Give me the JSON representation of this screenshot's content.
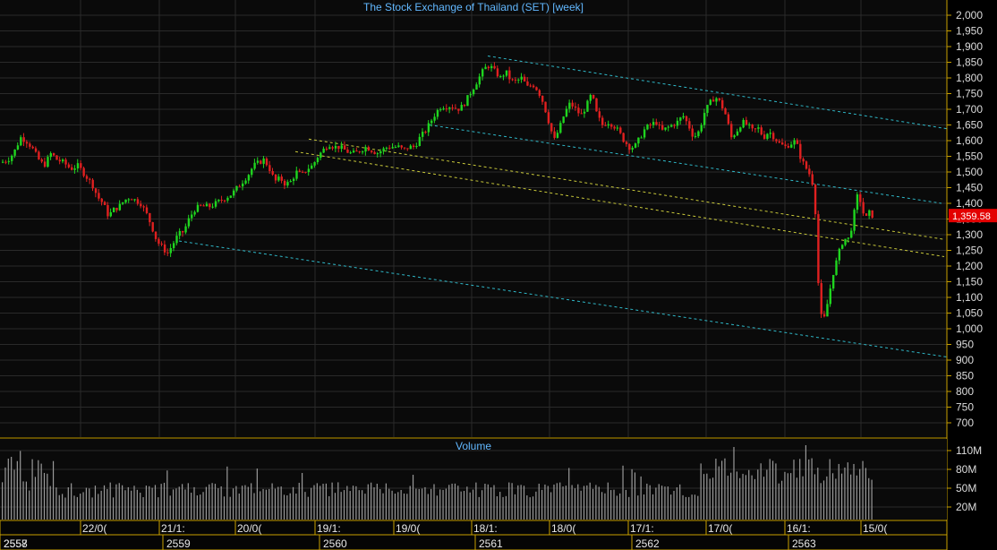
{
  "chart_data": [
    {
      "type": "candlestick",
      "title": "The Stock Exchange of Thailand (SET) [week]",
      "ylim": [
        650,
        2050
      ],
      "y_ticks": [
        "2,000",
        "1,950",
        "1,900",
        "1,850",
        "1,800",
        "1,750",
        "1,700",
        "1,650",
        "1,600",
        "1,550",
        "1,500",
        "1,450",
        "1,400",
        "1,350",
        "1,300",
        "1,250",
        "1,200",
        "1,150",
        "1,100",
        "1,050",
        "1,000",
        "950",
        "900",
        "850",
        "800",
        "750",
        "700"
      ],
      "last_price_label": "1,359.58",
      "last_price": 1359.58,
      "grid": true,
      "close_path": [
        [
          0,
          1530
        ],
        [
          8,
          1540
        ],
        [
          14,
          1560
        ],
        [
          22,
          1610
        ],
        [
          28,
          1600
        ],
        [
          34,
          1580
        ],
        [
          42,
          1540
        ],
        [
          48,
          1520
        ],
        [
          56,
          1560
        ],
        [
          62,
          1540
        ],
        [
          70,
          1530
        ],
        [
          78,
          1510
        ],
        [
          86,
          1520
        ],
        [
          94,
          1490
        ],
        [
          102,
          1460
        ],
        [
          108,
          1420
        ],
        [
          114,
          1400
        ],
        [
          120,
          1360
        ],
        [
          126,
          1380
        ],
        [
          132,
          1390
        ],
        [
          138,
          1410
        ],
        [
          144,
          1420
        ],
        [
          150,
          1410
        ],
        [
          156,
          1400
        ],
        [
          162,
          1370
        ],
        [
          168,
          1330
        ],
        [
          174,
          1280
        ],
        [
          180,
          1260
        ],
        [
          186,
          1240
        ],
        [
          192,
          1270
        ],
        [
          198,
          1300
        ],
        [
          204,
          1310
        ],
        [
          210,
          1350
        ],
        [
          216,
          1380
        ],
        [
          222,
          1390
        ],
        [
          228,
          1390
        ],
        [
          234,
          1390
        ],
        [
          240,
          1400
        ],
        [
          246,
          1410
        ],
        [
          252,
          1420
        ],
        [
          258,
          1430
        ],
        [
          264,
          1450
        ],
        [
          270,
          1470
        ],
        [
          276,
          1490
        ],
        [
          282,
          1520
        ],
        [
          288,
          1530
        ],
        [
          294,
          1540
        ],
        [
          300,
          1510
        ],
        [
          306,
          1470
        ],
        [
          312,
          1480
        ],
        [
          318,
          1460
        ],
        [
          324,
          1470
        ],
        [
          330,
          1500
        ],
        [
          336,
          1490
        ],
        [
          342,
          1510
        ],
        [
          348,
          1520
        ],
        [
          354,
          1550
        ],
        [
          360,
          1570
        ],
        [
          366,
          1590
        ],
        [
          372,
          1580
        ],
        [
          378,
          1580
        ],
        [
          384,
          1570
        ],
        [
          390,
          1560
        ],
        [
          396,
          1560
        ],
        [
          402,
          1570
        ],
        [
          408,
          1580
        ],
        [
          414,
          1570
        ],
        [
          420,
          1560
        ],
        [
          426,
          1570
        ],
        [
          432,
          1580
        ],
        [
          438,
          1580
        ],
        [
          444,
          1580
        ],
        [
          450,
          1570
        ],
        [
          456,
          1580
        ],
        [
          462,
          1580
        ],
        [
          468,
          1610
        ],
        [
          474,
          1630
        ],
        [
          480,
          1660
        ],
        [
          486,
          1690
        ],
        [
          492,
          1710
        ],
        [
          498,
          1710
        ],
        [
          504,
          1710
        ],
        [
          510,
          1700
        ],
        [
          516,
          1710
        ],
        [
          522,
          1740
        ],
        [
          528,
          1770
        ],
        [
          534,
          1800
        ],
        [
          540,
          1830
        ],
        [
          546,
          1840
        ],
        [
          552,
          1820
        ],
        [
          558,
          1800
        ],
        [
          564,
          1820
        ],
        [
          570,
          1790
        ],
        [
          576,
          1790
        ],
        [
          582,
          1800
        ],
        [
          588,
          1770
        ],
        [
          594,
          1780
        ],
        [
          600,
          1760
        ],
        [
          606,
          1720
        ],
        [
          612,
          1660
        ],
        [
          618,
          1600
        ],
        [
          624,
          1640
        ],
        [
          630,
          1690
        ],
        [
          636,
          1720
        ],
        [
          642,
          1700
        ],
        [
          648,
          1680
        ],
        [
          654,
          1710
        ],
        [
          660,
          1750
        ],
        [
          666,
          1680
        ],
        [
          672,
          1650
        ],
        [
          678,
          1660
        ],
        [
          684,
          1650
        ],
        [
          690,
          1630
        ],
        [
          696,
          1600
        ],
        [
          702,
          1580
        ],
        [
          708,
          1580
        ],
        [
          714,
          1610
        ],
        [
          720,
          1640
        ],
        [
          726,
          1650
        ],
        [
          732,
          1660
        ],
        [
          738,
          1630
        ],
        [
          744,
          1640
        ],
        [
          750,
          1650
        ],
        [
          756,
          1660
        ],
        [
          762,
          1680
        ],
        [
          768,
          1650
        ],
        [
          774,
          1610
        ],
        [
          780,
          1630
        ],
        [
          786,
          1690
        ],
        [
          792,
          1720
        ],
        [
          798,
          1740
        ],
        [
          804,
          1720
        ],
        [
          810,
          1680
        ],
        [
          816,
          1610
        ],
        [
          822,
          1630
        ],
        [
          828,
          1660
        ],
        [
          834,
          1650
        ],
        [
          840,
          1630
        ],
        [
          846,
          1640
        ],
        [
          852,
          1610
        ],
        [
          858,
          1630
        ],
        [
          864,
          1610
        ],
        [
          870,
          1590
        ],
        [
          876,
          1580
        ],
        [
          882,
          1590
        ],
        [
          888,
          1600
        ],
        [
          894,
          1540
        ],
        [
          900,
          1510
        ],
        [
          906,
          1480
        ],
        [
          910,
          1370
        ],
        [
          914,
          1090
        ],
        [
          918,
          1010
        ],
        [
          922,
          1060
        ],
        [
          926,
          1120
        ],
        [
          930,
          1180
        ],
        [
          934,
          1220
        ],
        [
          938,
          1260
        ],
        [
          942,
          1290
        ],
        [
          946,
          1280
        ],
        [
          950,
          1320
        ],
        [
          954,
          1380
        ],
        [
          958,
          1440
        ],
        [
          962,
          1380
        ],
        [
          966,
          1350
        ],
        [
          970,
          1370
        ],
        [
          974,
          1360
        ]
      ],
      "trend_lines": [
        {
          "color": "#2fb8c8",
          "from": [
            545,
            1870
          ],
          "to": [
            1058,
            1638
          ]
        },
        {
          "color": "#2fb8c8",
          "from": [
            480,
            1650
          ],
          "to": [
            1052,
            1400
          ]
        },
        {
          "color": "#2fb8c8",
          "from": [
            200,
            1280
          ],
          "to": [
            1058,
            910
          ]
        },
        {
          "color": "#c8c83a",
          "from": [
            345,
            1605
          ],
          "to": [
            1055,
            1285
          ]
        },
        {
          "color": "#c8c83a",
          "from": [
            330,
            1565
          ],
          "to": [
            1055,
            1230
          ]
        }
      ],
      "volume": {
        "title": "Volume",
        "y_ticks": [
          "110M",
          "80M",
          "50M",
          "20M"
        ],
        "max": 120
      },
      "x_labels": {
        "dates": [
          "22/0(",
          "21/1:",
          "20/0(",
          "19/1:",
          "19/0(",
          "18/1:",
          "18/0(",
          "17/1:",
          "17/0(",
          "16/1:",
          "15/0("
        ],
        "years": [
          "2558",
          "2559",
          "2560",
          "2561",
          "2562",
          "2563"
        ],
        "year_left_overlap": "2557"
      }
    }
  ]
}
